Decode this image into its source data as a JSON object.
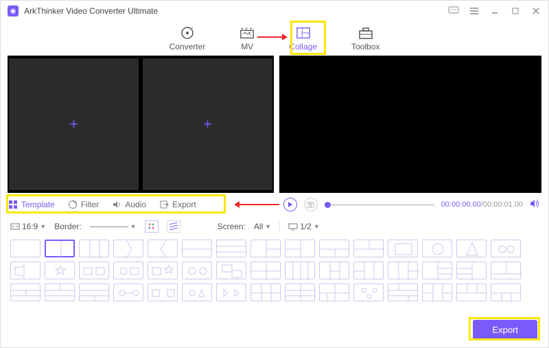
{
  "titlebar": {
    "title": "ArkThinker Video Converter Ultimate"
  },
  "nav": {
    "converter": "Converter",
    "mv": "MV",
    "collage": "Collage",
    "toolbox": "Toolbox"
  },
  "tabs": {
    "template": "Template",
    "filter": "Filter",
    "audio": "Audio",
    "export": "Export"
  },
  "playback": {
    "current": "00:00:00.00",
    "duration": "00:00:01.00"
  },
  "options": {
    "aspect_label": "16:9",
    "border_label": "Border:",
    "screen_label": "Screen:",
    "screen_value": "All",
    "page_value": "1/2"
  },
  "footer": {
    "export": "Export"
  }
}
